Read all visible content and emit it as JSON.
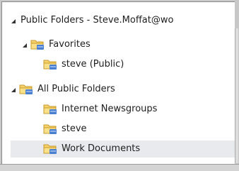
{
  "tree": {
    "root": {
      "label": "Public Folders - Steve.Moffat@wo",
      "expanded": true
    },
    "favorites": {
      "label": "Favorites",
      "expanded": true,
      "children": [
        "steve (Public)"
      ]
    },
    "all_public": {
      "label": "All Public Folders",
      "expanded": true,
      "children": [
        "Internet Newsgroups",
        "steve",
        "Work Documents"
      ]
    },
    "selected": "Work Documents"
  },
  "icons": {
    "expand_arrow": "expanded-triangle-icon",
    "folder": "public-folder-icon"
  },
  "colors": {
    "background": "#ffffff",
    "selection": "#e8eaed",
    "folder_fill": "#f7d26b",
    "folder_accent": "#4a7fd0"
  }
}
